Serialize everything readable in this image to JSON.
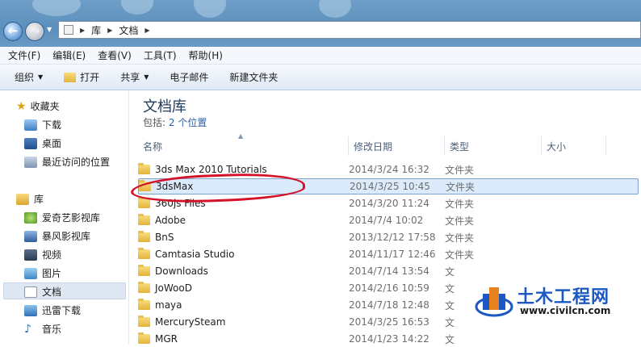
{
  "address": {
    "path": [
      "库",
      "文档"
    ]
  },
  "menu": [
    "文件(F)",
    "编辑(E)",
    "查看(V)",
    "工具(T)",
    "帮助(H)"
  ],
  "toolbar": {
    "organize": "组织",
    "open": "打开",
    "share": "共享",
    "email": "电子邮件",
    "new_folder": "新建文件夹"
  },
  "sidebar": {
    "favorites": {
      "label": "收藏夹",
      "items": [
        "下载",
        "桌面",
        "最近访问的位置"
      ]
    },
    "libraries": {
      "label": "库",
      "items": [
        "爱奇艺影视库",
        "暴风影视库",
        "视频",
        "图片",
        "文档",
        "迅雷下载",
        "音乐"
      ],
      "selected": "文档"
    }
  },
  "library": {
    "title": "文档库",
    "includes_label": "包括:",
    "includes_link": "2 个位置"
  },
  "columns": [
    "名称",
    "修改日期",
    "类型",
    "大小"
  ],
  "files": [
    {
      "name": "3ds Max 2010 Tutorials",
      "date": "2014/3/24 16:32",
      "type": "文件夹"
    },
    {
      "name": "3dsMax",
      "date": "2014/3/25 10:45",
      "type": "文件夹"
    },
    {
      "name": "360js Files",
      "date": "2014/3/20 11:24",
      "type": "文件夹"
    },
    {
      "name": "Adobe",
      "date": "2014/7/4 10:02",
      "type": "文件夹"
    },
    {
      "name": "BnS",
      "date": "2013/12/12 17:58",
      "type": "文件夹"
    },
    {
      "name": "Camtasia Studio",
      "date": "2014/11/17 12:46",
      "type": "文件夹"
    },
    {
      "name": "Downloads",
      "date": "2014/7/14 13:54",
      "type": "文"
    },
    {
      "name": "JoWooD",
      "date": "2014/2/16 10:59",
      "type": "文"
    },
    {
      "name": "maya",
      "date": "2014/7/18 12:48",
      "type": "文"
    },
    {
      "name": "MercurySteam",
      "date": "2014/3/25 16:53",
      "type": "文"
    },
    {
      "name": "MGR",
      "date": "2014/1/23 14:22",
      "type": "文"
    }
  ],
  "selected_file": "3dsMax",
  "watermark": {
    "title": "土木工程网",
    "url": "www.civilcn.com"
  },
  "colors": {
    "accent": "#1e395b",
    "selection": "#dcebfc",
    "annotation": "#d3122a",
    "watermark": "#1c58c2"
  }
}
